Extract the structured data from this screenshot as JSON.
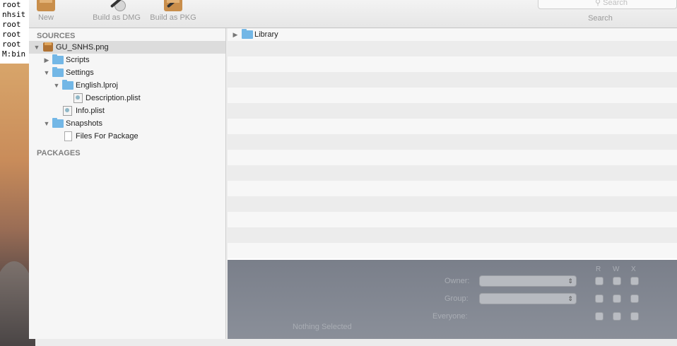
{
  "terminal": {
    "lines": [
      "root",
      "nhsit",
      "root",
      "root",
      "root",
      "M:bin"
    ]
  },
  "toolbar": {
    "new_label": "New",
    "build_dmg_label": "Build as DMG",
    "build_pkg_label": "Build as PKG",
    "search_placeholder": "Search",
    "search_label": "Search"
  },
  "sidebar": {
    "sources_header": "SOURCES",
    "packages_header": "PACKAGES",
    "items": [
      {
        "label": "GU_SNHS.png",
        "icon": "package-icon",
        "expanded": true,
        "selected": true
      },
      {
        "label": "Scripts",
        "icon": "folder-icon",
        "expanded": false
      },
      {
        "label": "Settings",
        "icon": "folder-icon",
        "expanded": true
      },
      {
        "label": "English.lproj",
        "icon": "folder-icon",
        "expanded": true
      },
      {
        "label": "Description.plist",
        "icon": "plist-icon"
      },
      {
        "label": "Info.plist",
        "icon": "plist-icon"
      },
      {
        "label": "Snapshots",
        "icon": "folder-icon",
        "expanded": true
      },
      {
        "label": "Files For Package",
        "icon": "document-icon"
      }
    ]
  },
  "file_list": {
    "rows": [
      {
        "label": "Library",
        "icon": "folder-icon",
        "expanded": false
      }
    ]
  },
  "inspector": {
    "owner_label": "Owner:",
    "group_label": "Group:",
    "everyone_label": "Everyone:",
    "col_r": "R",
    "col_w": "W",
    "col_x": "X",
    "nothing_selected": "Nothing Selected"
  }
}
